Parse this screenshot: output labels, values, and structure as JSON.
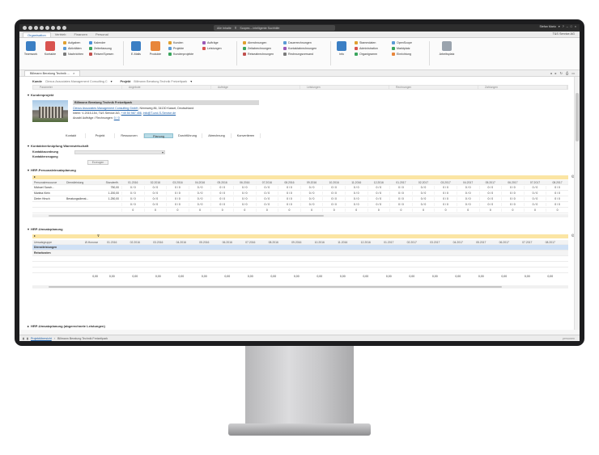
{
  "titlebar": {
    "search_scope": "Alle Inhalte",
    "search_placeholder": "Scopes – intelligente Suchhilfe",
    "user": "Stefan Mario",
    "icons": [
      "home-icon",
      "back-icon",
      "forward-icon",
      "print-icon",
      "mail-icon",
      "new-icon",
      "info-icon",
      "refresh-icon"
    ]
  },
  "menubar": {
    "tabs": [
      "Organisation",
      "Vertrieb",
      "Finanzen",
      "Personal"
    ],
    "active_tab": "Organisation",
    "company": "T&S Service AG"
  },
  "ribbon": {
    "big_teamwork": "Teamwork",
    "big_kontakte": "Kontakte",
    "col1": [
      "Aufgaben",
      "Aktivitäten",
      "Nachrichten"
    ],
    "col2": [
      "Kalender",
      "Zeiterfassung",
      "Reisen/Spesen"
    ],
    "big_emails": "E-Mails",
    "big_produkte": "Produkte",
    "col3": [
      "Kunden",
      "Projekte",
      "Kundenprojekte"
    ],
    "col4": [
      "Aufträge",
      "Leistungen"
    ],
    "col5": [
      "Abrechnungen",
      "Zeitabrechnungen",
      "Reiseabrechnungen"
    ],
    "col6": [
      "Dauerrechnungen",
      "Kontaktabrechnungen",
      "Rechnungsversand"
    ],
    "big_info": "Info",
    "col7": [
      "Stammdaten",
      "Administration",
      "Organigramm"
    ],
    "col8": [
      "OpenScope",
      "Marktplatz",
      "Einrichtung"
    ],
    "big_arbeitsplatz": "Arbeitsplatz"
  },
  "doctab": {
    "title": "Billmann Beratung Technik ..."
  },
  "header_row": {
    "kunde_label": "Kunde",
    "kunde_value": "Clexus Associates Management Consulting C",
    "projekt_label": "Projekt",
    "projekt_value": "Billmann Beratung Technik Freizeitpark"
  },
  "grid_header": [
    "Parameter",
    "Angebote",
    "Aufträge",
    "Leistungen",
    "Rechnungen",
    "Zahlungen"
  ],
  "kundenprojekt": {
    "section_title": "Kundenprojekt",
    "title": "Billmann Beratung Technik Freizeitpark",
    "company_link": "Clexus Associates Management Consulting GmbH",
    "address": ", Nimmweg 86, 34130 Kassel, Deutschland",
    "intern_prefix": "Intern: V-2015-154, T&S Service AG, ",
    "phone": "+49 50 987 456",
    "email": "info@T-und-S-Service.de",
    "orders_prefix": "Anzahl Aufträge / Rechnungen: ",
    "orders_value": "0 / 0"
  },
  "phases": [
    "Kontakt",
    "Projekt",
    "Ressourcen",
    "Planung",
    "Durchführung",
    "Abrechnung",
    "Konvertieren"
  ],
  "active_phase": "Planung",
  "kontaktverknuepfung": {
    "section_title": "Kontaktverknüpfung Warenwirtschaft",
    "field1": "Kontaktzuordnung",
    "field2": "Kontakterzeugung",
    "button": "Erzeugen"
  },
  "personal": {
    "section_title": "HRP-Personaleinsatzplanung",
    "head": {
      "c1": "Personalressource",
      "c2": "Dienstleistung",
      "c3": "Stundenfh.",
      "months": [
        "01.2016",
        "02.2016",
        "03.2016",
        "04.2016",
        "05.2016",
        "06.2016",
        "07.2016",
        "08.2016",
        "09.2016",
        "10.2016",
        "11.2016",
        "12.2016",
        "01.2017",
        "02.2017",
        "03.2017",
        "04.2017",
        "05.2017",
        "06.2017",
        "07.2017",
        "08.2017"
      ]
    },
    "rows": [
      {
        "name": "Michael Sanch...",
        "service": "",
        "hours": "750,00",
        "cells": "0 / 0"
      },
      {
        "name": "Martina Klein",
        "service": "",
        "hours": "1.200,00",
        "cells": "0 / 0"
      },
      {
        "name": "Dieter Hirsch",
        "service": "Beratungsdienst...",
        "hours": "1.250,00",
        "cells": "0 / 0"
      },
      {
        "name": "",
        "service": "",
        "hours": "",
        "cells": "0 / 0"
      },
      {
        "name": "",
        "service": "",
        "hours": "",
        "cells": "0"
      }
    ]
  },
  "umsatz": {
    "section_title": "HRP-Umsatzplanung",
    "head": {
      "c1": "Umsatzgruppe",
      "c2": "Ø-Honorar",
      "months": [
        "01.2016",
        "02.2016",
        "03.2016",
        "04.2016",
        "05.2016",
        "06.2016",
        "07.2016",
        "08.2016",
        "09.2016",
        "10.2016",
        "11.2016",
        "12.2016",
        "01.2017",
        "02.2017",
        "03.2017",
        "04.2017",
        "05.2017",
        "06.2017",
        "07.2017",
        "08.2017"
      ]
    },
    "rows": [
      "Dienstleistungen",
      "Reisekosten"
    ],
    "totals": "0,00"
  },
  "umsatz2": {
    "section_title": "HRP-Umsatzplanung (abgerechnete Leistungen)"
  },
  "status": {
    "link": "Projektübersicht",
    "current": "Billmann Beratung Technik Freizeitpark",
    "zoom": "personen"
  },
  "colors": {
    "accent": "#1d5fa8",
    "yellow_band": "#fbe5a3",
    "active_phase": "#b9dbe6",
    "selected_row": "#cfe0f5"
  }
}
